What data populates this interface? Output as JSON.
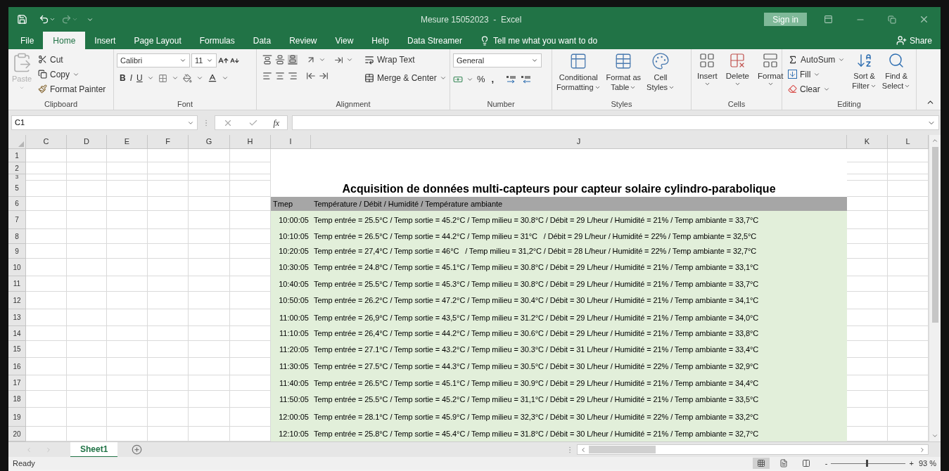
{
  "window": {
    "title": "Mesure 15052023  -  Excel",
    "sign_in": "Sign in"
  },
  "menu_tabs": [
    {
      "label": "File",
      "selected": false
    },
    {
      "label": "Home",
      "selected": true
    },
    {
      "label": "Insert",
      "selected": false
    },
    {
      "label": "Page Layout",
      "selected": false
    },
    {
      "label": "Formulas",
      "selected": false
    },
    {
      "label": "Data",
      "selected": false
    },
    {
      "label": "Review",
      "selected": false
    },
    {
      "label": "View",
      "selected": false
    },
    {
      "label": "Help",
      "selected": false
    },
    {
      "label": "Data Streamer",
      "selected": false
    }
  ],
  "tell_me": {
    "placeholder": "Tell me what you want to do"
  },
  "share": "Share",
  "ribbon": {
    "clipboard": {
      "label": "Clipboard",
      "paste": {
        "label": "Paste",
        "disabled": true
      },
      "cut": "Cut",
      "copy": "Copy",
      "format_painter": "Format Painter"
    },
    "font": {
      "label": "Font",
      "family": "Calibri",
      "size": "11",
      "bold": "B",
      "italic": "I",
      "underline": "U"
    },
    "alignment": {
      "label": "Alignment",
      "wrap_text": "Wrap Text",
      "merge_center": "Merge & Center"
    },
    "number": {
      "label": "Number",
      "format": "General",
      "percent": "%",
      "comma": ","
    },
    "styles": {
      "label": "Styles",
      "buttons": [
        [
          "Conditional",
          "Formatting"
        ],
        [
          "Format as",
          "Table"
        ],
        [
          "Cell",
          "Styles"
        ]
      ]
    },
    "cells": {
      "label": "Cells",
      "buttons": [
        "Insert",
        "Delete",
        "Format"
      ]
    },
    "editing": {
      "label": "Editing",
      "autosum": "AutoSum",
      "fill": "Fill",
      "clear": "Clear",
      "buttons": [
        [
          "Sort &",
          "Filter"
        ],
        [
          "Find &",
          "Select"
        ]
      ]
    }
  },
  "formula_bar": {
    "name_box": "C1",
    "function_label": "fx"
  },
  "columns": [
    "C",
    "D",
    "E",
    "F",
    "G",
    "H",
    "I",
    "J",
    "K",
    "L"
  ],
  "rows": [
    {
      "number": "1",
      "kind": "blank"
    },
    {
      "number": "2",
      "kind": "blank"
    },
    {
      "number": "3",
      "kind": "blank"
    },
    {
      "number": "5",
      "kind": "title",
      "text": "Acquisition de données multi-capteurs pour capteur solaire cylindro-parabolique"
    },
    {
      "number": "6",
      "kind": "header",
      "time": "Tmep",
      "text": "Température / Débit / Humidité / Température ambiante"
    },
    {
      "number": "7",
      "kind": "data",
      "time": "10:00:05",
      "text": "Temp entrée = 25.5°C / Temp sortie = 45.2°C / Temp milieu = 30.8°C / Débit = 29 L/heur / Humidité = 21% / Temp ambiante = 33,7°C"
    },
    {
      "number": "8",
      "kind": "data",
      "time": "10:10:05",
      "text": "Temp entrée = 26.5°C / Temp sortie = 44.2°C / Temp milieu = 31°C   / Débit = 29 L/heur / Humidité = 22% / Temp ambiante = 32,5°C"
    },
    {
      "number": "9",
      "kind": "data",
      "time": "10:20:05",
      "text": "Temp entrée = 27,4°C / Temp sortie = 46°C   / Temp milieu = 31,2°C / Débit = 28 L/heur / Humidité = 22% / Temp ambiante = 32,7°C"
    },
    {
      "number": "10",
      "kind": "data",
      "time": "10:30:05",
      "text": "Temp entrée = 24.8°C / Temp sortie = 45.1°C / Temp milieu = 30.8°C / Débit = 29 L/heur / Humidité = 21% / Temp ambiante = 33,1°C"
    },
    {
      "number": "11",
      "kind": "data",
      "time": "10:40:05",
      "text": "Temp entrée = 25.5°C / Temp sortie = 45.3°C / Temp milieu = 30.8°C / Débit = 29 L/heur / Humidité = 21% / Temp ambiante = 33,7°C"
    },
    {
      "number": "12",
      "kind": "data",
      "time": "10:50:05",
      "text": "Temp entrée = 26.2°C / Temp sortie = 47.2°C / Temp milieu = 30.4°C / Débit = 30 L/heur / Humidité = 21% / Temp ambiante = 34,1°C"
    },
    {
      "number": "13",
      "kind": "data",
      "time": "11:00:05",
      "text": "Temp entrée = 26,9°C / Temp sortie = 43,5°C / Temp milieu = 31.2°C / Débit = 29 L/heur / Humidité = 21% / Temp ambiante = 34,0°C"
    },
    {
      "number": "14",
      "kind": "data",
      "time": "11:10:05",
      "text": "Temp entrée = 26,4°C / Temp sortie = 44.2°C / Temp milieu = 30.6°C / Débit = 29 L/heur / Humidité = 21% / Temp ambiante = 33,8°C"
    },
    {
      "number": "15",
      "kind": "data",
      "time": "11:20:05",
      "text": "Temp entrée = 27.1°C / Temp sortie = 43.2°C / Temp milieu = 30.3°C / Débit = 31 L/heur / Humidité = 21% / Temp ambiante = 33,4°C"
    },
    {
      "number": "16",
      "kind": "data",
      "time": "11:30:05",
      "text": "Temp entrée = 27.5°C / Temp sortie = 44.3°C / Temp milieu = 30.5°C / Débit = 30 L/heur / Humidité = 22% / Temp ambiante = 32,9°C"
    },
    {
      "number": "17",
      "kind": "data",
      "time": "11:40:05",
      "text": "Temp entrée = 26.5°C / Temp sortie = 45.1°C / Temp milieu = 30.9°C / Débit = 29 L/heur / Humidité = 21% / Temp ambiante = 34,4°C"
    },
    {
      "number": "18",
      "kind": "data",
      "time": "11:50:05",
      "text": "Temp entrée = 25.5°C / Temp sortie = 45.2°C / Temp milieu = 31,1°C / Débit = 29 L/heur / Humidité = 21% / Temp ambiante = 33,5°C"
    },
    {
      "number": "19",
      "kind": "data",
      "time": "12:00:05",
      "text": "Temp entrée = 28.1°C / Temp sortie = 45.9°C / Temp milieu = 32,3°C / Débit = 30 L/heur / Humidité = 22% / Temp ambiante = 33,2°C"
    },
    {
      "number": "20",
      "kind": "data",
      "time": "12:10:05",
      "text": "Temp entrée = 25.8°C / Temp sortie = 45.4°C / Temp milieu = 31.8°C / Débit = 30 L/heur / Humidité = 21% / Temp ambiante = 32,7°C"
    }
  ],
  "sheet_tabs": [
    {
      "label": "Sheet1",
      "selected": true
    }
  ],
  "status_bar": {
    "status": "Ready",
    "views": [
      {
        "selected": true
      },
      {
        "selected": false
      },
      {
        "selected": false
      }
    ],
    "zoom_minus": "-",
    "zoom_plus": "+",
    "zoom": {
      "level": 0.47
    },
    "zoom_reading": "93 %"
  }
}
